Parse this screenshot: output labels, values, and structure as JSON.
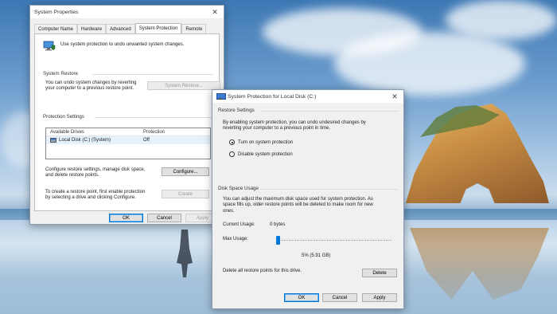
{
  "system_properties": {
    "title": "System Properties",
    "close": "✕",
    "tabs": [
      {
        "label": "Computer Name"
      },
      {
        "label": "Hardware"
      },
      {
        "label": "Advanced"
      },
      {
        "label": "System Protection",
        "active": true
      },
      {
        "label": "Remote"
      }
    ],
    "intro": "Use system protection to undo unwanted system changes.",
    "restore": {
      "heading": "System Restore",
      "text": [
        "You can undo system changes by reverting",
        "your computer to a previous restore point."
      ],
      "button": "System Restore..."
    },
    "protection": {
      "heading": "Protection Settings",
      "col_drives": "Available Drives",
      "col_protection": "Protection",
      "drive_name": "Local Disk (C:) (System)",
      "drive_status": "Off",
      "configure_text": [
        "Configure restore settings, manage disk space,",
        "and delete restore points."
      ],
      "configure_button": "Configure...",
      "create_text": [
        "To create a restore point, first enable protection",
        "by selecting a drive and clicking Configure."
      ],
      "create_button": "Create"
    },
    "buttons": {
      "ok": "OK",
      "cancel": "Cancel",
      "apply": "Apply"
    }
  },
  "protection_dialog": {
    "title": "System Protection for Local Disk (C:)",
    "close": "✕",
    "restore_settings": {
      "heading": "Restore Settings",
      "text": [
        "By enabling system protection, you can undo undesired changes by",
        "reverting your computer to a previous point in time."
      ],
      "option_on": "Turn on system protection",
      "option_off": "Disable system protection",
      "selected": "on"
    },
    "disk_usage": {
      "heading": "Disk Space Usage",
      "text": [
        "You can adjust the maximum disk space used for system protection. As",
        "space fills up, older restore points will be deleted to make room for new",
        "ones."
      ],
      "current_label": "Current Usage:",
      "current_value": "0 bytes",
      "max_label": "Max Usage:",
      "max_value": "5% (5.91 GB)",
      "max_fraction": 0.02,
      "delete_text": "Delete all restore points for this drive.",
      "delete_button": "Delete"
    },
    "buttons": {
      "ok": "OK",
      "cancel": "Cancel",
      "apply": "Apply"
    }
  }
}
